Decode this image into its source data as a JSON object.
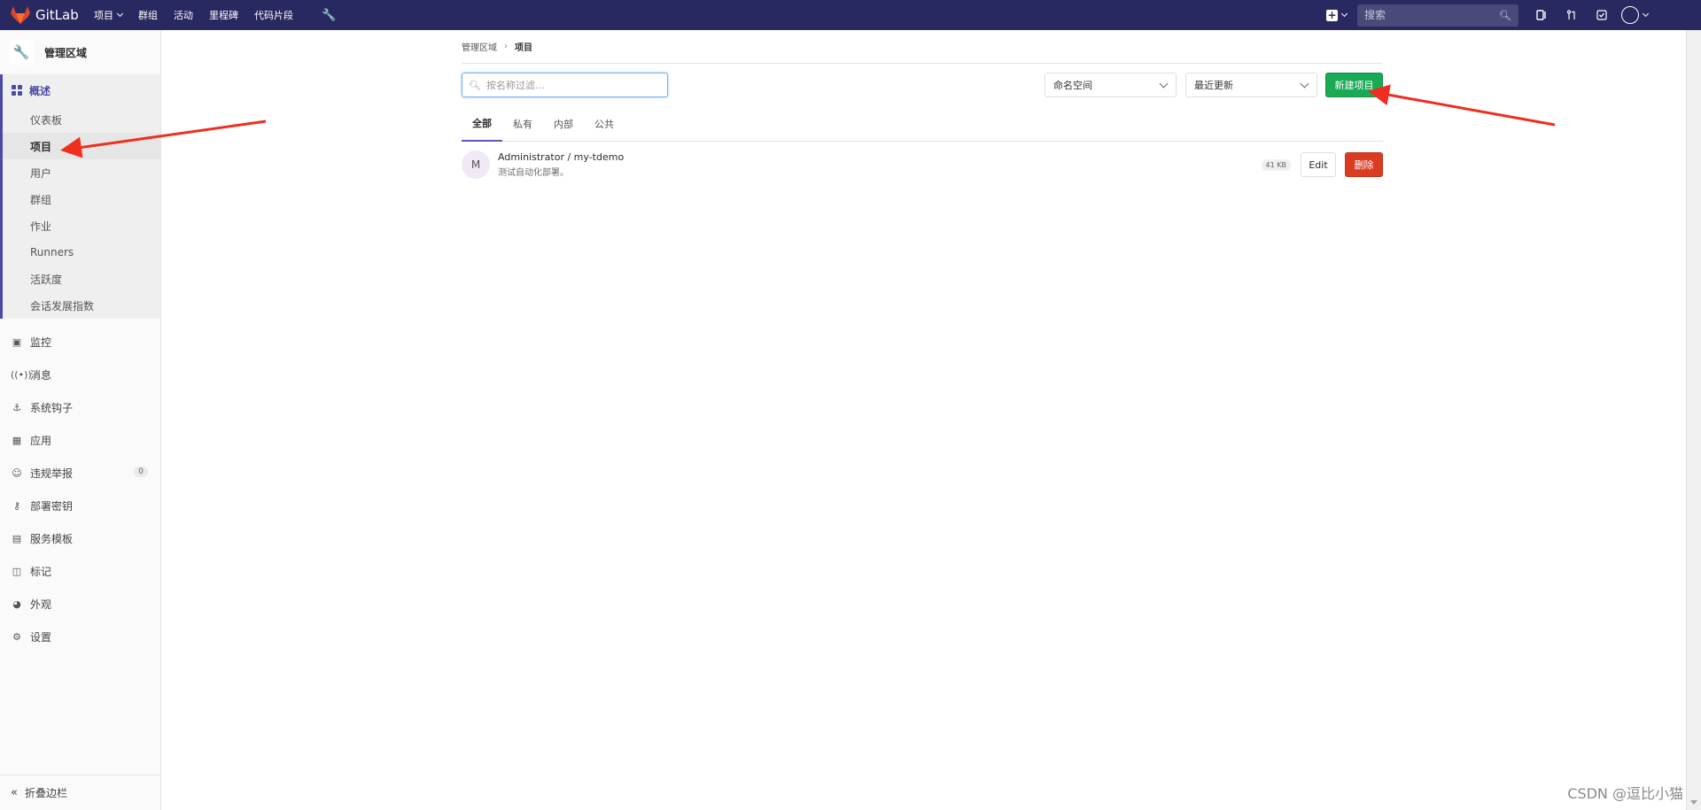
{
  "topbar": {
    "brand": "GitLab",
    "nav": [
      {
        "label": "项目",
        "has_caret": true
      },
      {
        "label": "群组"
      },
      {
        "label": "活动"
      },
      {
        "label": "里程碑"
      },
      {
        "label": "代码片段"
      }
    ],
    "search_placeholder": "搜索",
    "colors": {
      "bg": "#292961"
    }
  },
  "sidebar": {
    "context_title": "管理区域",
    "section": {
      "label": "概述",
      "items": [
        {
          "label": "仪表板"
        },
        {
          "label": "项目",
          "active": true
        },
        {
          "label": "用户"
        },
        {
          "label": "群组"
        },
        {
          "label": "作业"
        },
        {
          "label": "Runners"
        },
        {
          "label": "活跃度"
        },
        {
          "label": "会话发展指数"
        }
      ]
    },
    "nav": [
      {
        "label": "监控",
        "icon": "monitor-icon"
      },
      {
        "label": "消息",
        "icon": "broadcast-icon"
      },
      {
        "label": "系统钩子",
        "icon": "hook-icon"
      },
      {
        "label": "应用",
        "icon": "apps-icon"
      },
      {
        "label": "违规举报",
        "icon": "report-icon",
        "badge": "0"
      },
      {
        "label": "部署密钥",
        "icon": "key-icon"
      },
      {
        "label": "服务模板",
        "icon": "template-icon"
      },
      {
        "label": "标记",
        "icon": "label-icon"
      },
      {
        "label": "外观",
        "icon": "appearance-icon"
      },
      {
        "label": "设置",
        "icon": "settings-icon"
      }
    ],
    "collapse_label": "折叠边栏"
  },
  "main": {
    "breadcrumb": {
      "parent": "管理区域",
      "current": "项目"
    },
    "filter_placeholder": "按名称过滤...",
    "namespace_select": "命名空间",
    "sort_select": "最近更新",
    "new_project_label": "新建项目",
    "tabs": [
      {
        "label": "全部",
        "active": true
      },
      {
        "label": "私有"
      },
      {
        "label": "内部"
      },
      {
        "label": "公共"
      }
    ],
    "projects": [
      {
        "avatar_letter": "M",
        "name": "Administrator / my-tdemo",
        "description": "测试自动化部署。",
        "size": "41 KB",
        "edit_label": "Edit",
        "delete_label": "删除"
      }
    ],
    "colors": {
      "new_button": "#1aaa55",
      "delete_button": "#db3b21",
      "accent": "#4b4ba3"
    }
  },
  "watermark": "CSDN @逗比小猫"
}
